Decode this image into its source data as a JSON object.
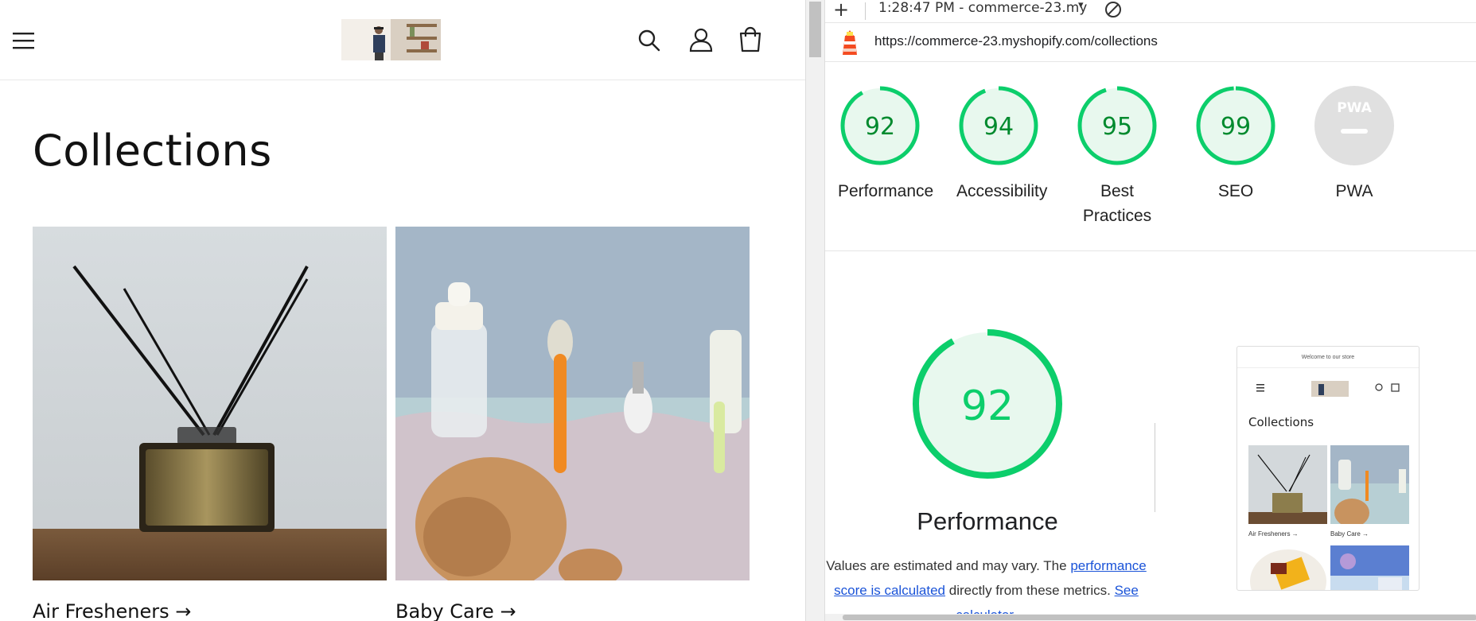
{
  "store": {
    "page_title": "Collections",
    "collections": [
      {
        "label": "Air Fresheners",
        "arrow": "→"
      },
      {
        "label": "Baby Care",
        "arrow": "→"
      }
    ],
    "icons": [
      "menu-icon",
      "search-icon",
      "account-icon",
      "cart-icon"
    ]
  },
  "lighthouse": {
    "topbar": {
      "add_symbol": "+",
      "run_label": "1:28:47 PM - commerce-23.my",
      "dropdown_symbol": "▾",
      "icons": [
        "add-icon",
        "dropdown-icon",
        "clear-icon"
      ]
    },
    "url": "https://commerce-23.myshopify.com/collections",
    "kebab_symbol": "⋮",
    "scores": [
      {
        "label": "Performance",
        "value": "92",
        "score": 92
      },
      {
        "label": "Accessibility",
        "value": "94",
        "score": 94
      },
      {
        "label": "Best Practices",
        "value": "95",
        "score": 95
      },
      {
        "label": "SEO",
        "value": "99",
        "score": 99
      },
      {
        "label": "PWA",
        "value": "",
        "score": null
      }
    ],
    "performance_section": {
      "score": 92,
      "score_text": "92",
      "heading": "Performance",
      "desc_part1": "Values are estimated and may vary. The ",
      "link_text": "performance score is calculated",
      "desc_part2": " directly from these metrics. ",
      "calc_link": "See calculator."
    },
    "screenshot_thumb": {
      "welcome": "Welcome to our store",
      "title": "Collections",
      "labels": [
        "Air Fresheners →",
        "Baby Care →"
      ]
    },
    "colors": {
      "pass_green": "#0cce6b",
      "pass_text": "#008a2e",
      "pass_fill": "#e8f8ee",
      "na_gray": "#e0e0e0",
      "link_blue": "#1a53d8"
    }
  }
}
